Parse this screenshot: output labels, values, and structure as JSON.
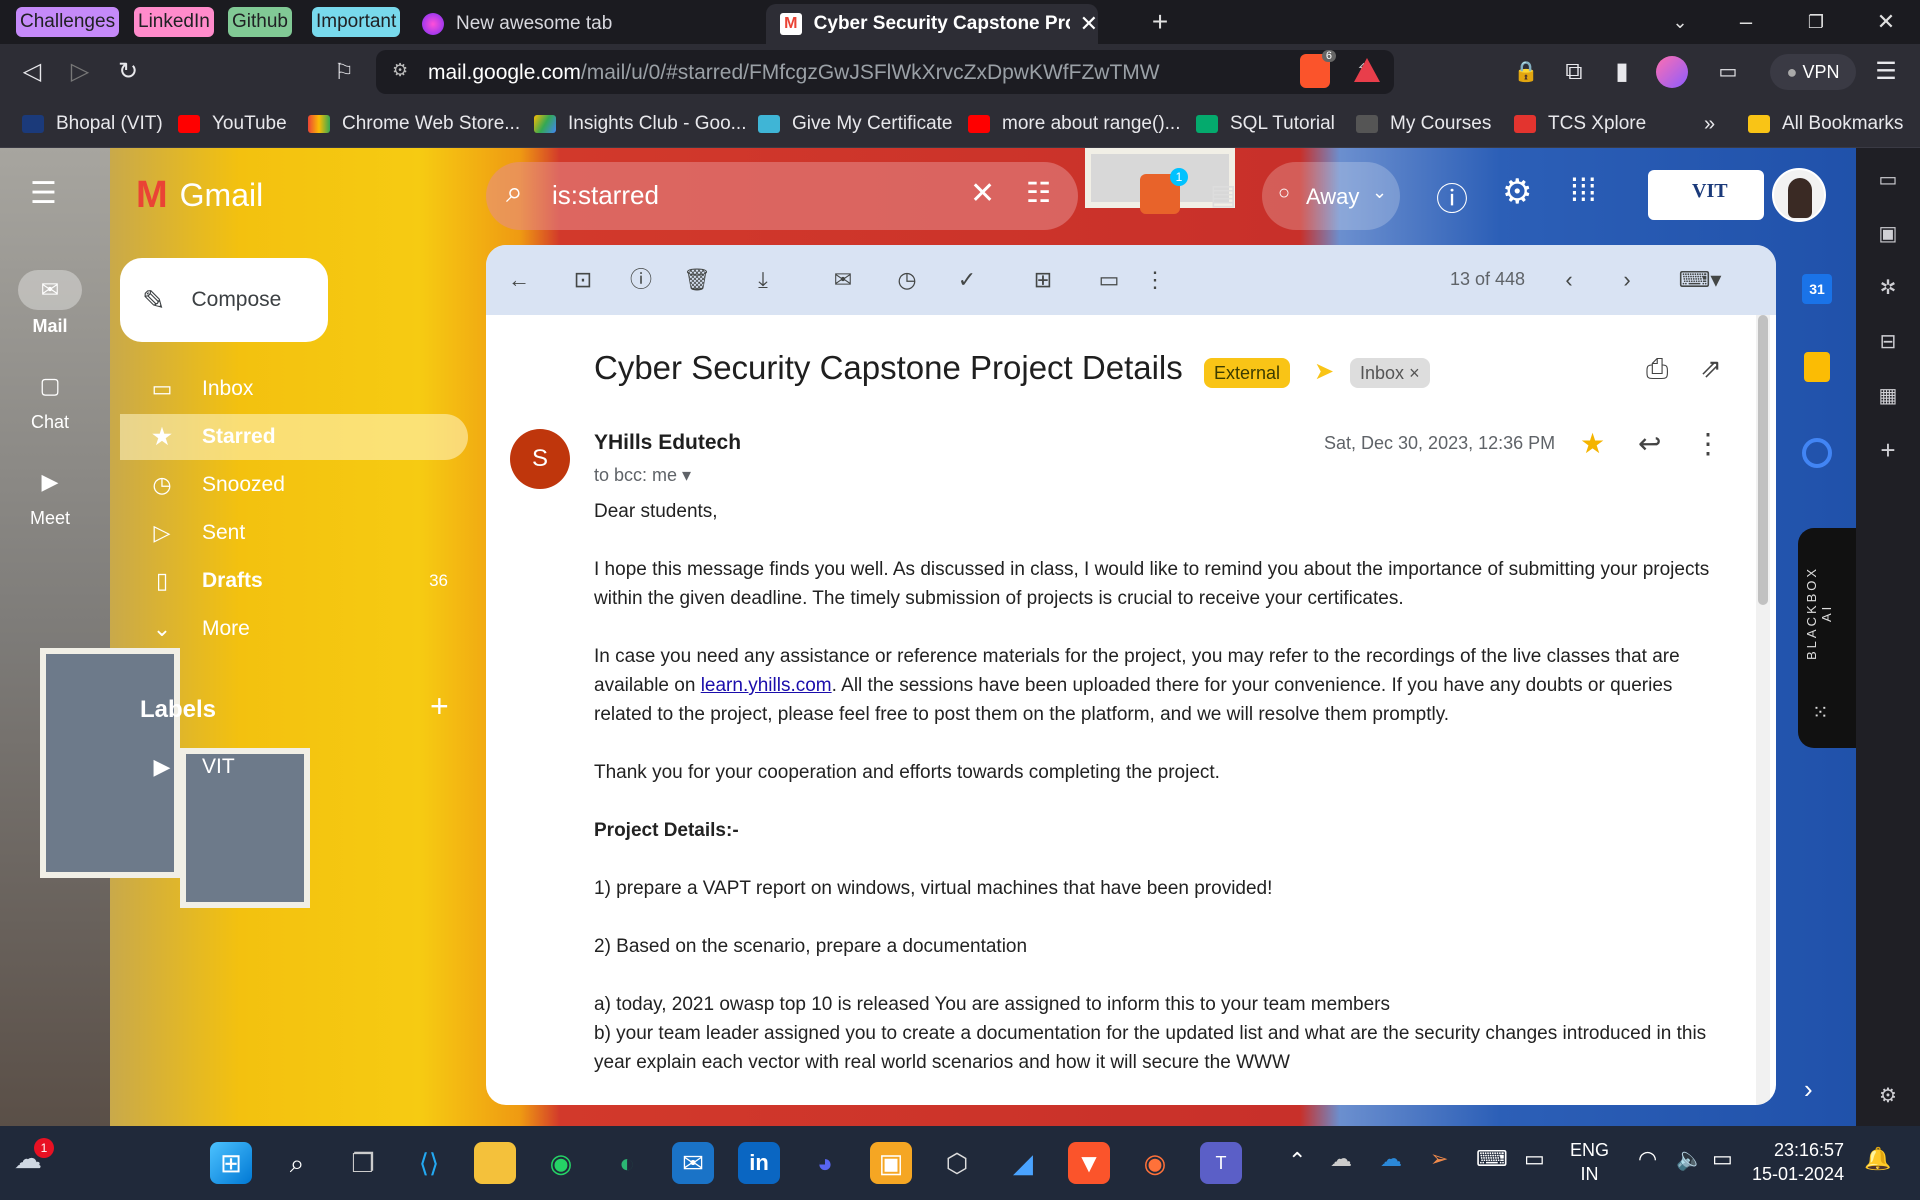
{
  "browser": {
    "tab_groups": [
      "Challenges",
      "LinkedIn",
      "Github",
      "Important"
    ],
    "tabs": [
      {
        "title": "New awesome tab"
      },
      {
        "title": "Cyber Security Capstone Project"
      }
    ],
    "url_host": "mail.google.com",
    "url_path": "/mail/u/0/#starred/FMfcgzGwJSFlWkXrvcZxDpwKWfFZwTMW",
    "brave_badge": "6",
    "vpn_label": "VPN",
    "bookmarks": [
      "Bhopal (VIT)",
      "YouTube",
      "Chrome Web Store...",
      "Insights Club - Goo...",
      "Give My Certificate",
      "more about range()...",
      "SQL Tutorial",
      "My Courses",
      "TCS Xplore"
    ],
    "bookmarks_overflow": "»",
    "all_bookmarks": "All Bookmarks"
  },
  "gmail": {
    "logo_text": "Gmail",
    "search_query": "is:starred",
    "status": "Away",
    "notif_badge": "1",
    "org_logo_text": "VIT",
    "rail": [
      {
        "label": "Mail",
        "icon": "mail-icon"
      },
      {
        "label": "Chat",
        "icon": "chat-icon"
      },
      {
        "label": "Meet",
        "icon": "video-icon"
      }
    ],
    "compose_label": "Compose",
    "nav": [
      {
        "label": "Inbox",
        "icon": "inbox-icon",
        "count": ""
      },
      {
        "label": "Starred",
        "icon": "star-icon",
        "count": ""
      },
      {
        "label": "Snoozed",
        "icon": "clock-icon",
        "count": ""
      },
      {
        "label": "Sent",
        "icon": "send-icon",
        "count": ""
      },
      {
        "label": "Drafts",
        "icon": "draft-icon",
        "count": "36"
      },
      {
        "label": "More",
        "icon": "chevron-down-icon",
        "count": ""
      }
    ],
    "labels_heading": "Labels",
    "labels": [
      "VIT"
    ],
    "pager": "13 of 448"
  },
  "email": {
    "subject": "Cyber Security Capstone Project Details",
    "badge_external": "External",
    "badge_inbox": "Inbox",
    "sender_initial": "S",
    "sender": "YHills Edutech",
    "recipients": "to bcc: me",
    "date": "Sat, Dec 30, 2023, 12:36 PM",
    "greeting": "Dear students,",
    "p1": "I hope this message finds you well. As discussed in class, I would like to remind you about the importance of submitting your projects within the given deadline. The timely submission of projects is crucial to receive your certificates.",
    "p2_before": "In case you need any assistance or reference materials for the project, you may refer to the recordings of the live classes that are available on ",
    "p2_link": "learn.yhills.com",
    "p2_after": ". All the sessions have been uploaded there for your convenience. If you have any doubts or queries related to the project, please feel free to post them on the platform, and we will resolve them promptly.",
    "p3": "Thank you for your cooperation and efforts towards completing the project.",
    "details_heading": "Project Details:-",
    "item1": "1) prepare a VAPT report on windows, virtual machines that have been provided!",
    "item2": "2) Based on the scenario, prepare a documentation",
    "item_a": "a) today, 2021 owasp top 10 is released You are assigned to inform this to your team members",
    "item_b": "b) your team leader assigned you to create a documentation for the updated list and what are the security changes introduced in this year explain each vector with real world scenarios and how it will secure the WWW"
  },
  "side_panel": {
    "calendar_day": "31",
    "blackbox_label": "BLACKBOX AI"
  },
  "taskbar": {
    "weather_badge": "1",
    "lang_top": "ENG",
    "lang_bottom": "IN",
    "time": "23:16:57",
    "date": "15-01-2024"
  },
  "colors": {
    "gmail_red": "#ea4335",
    "external_badge": "#f9c416",
    "avatar_red": "#bf360c",
    "star": "#f4b400",
    "link": "#1a0dab"
  }
}
